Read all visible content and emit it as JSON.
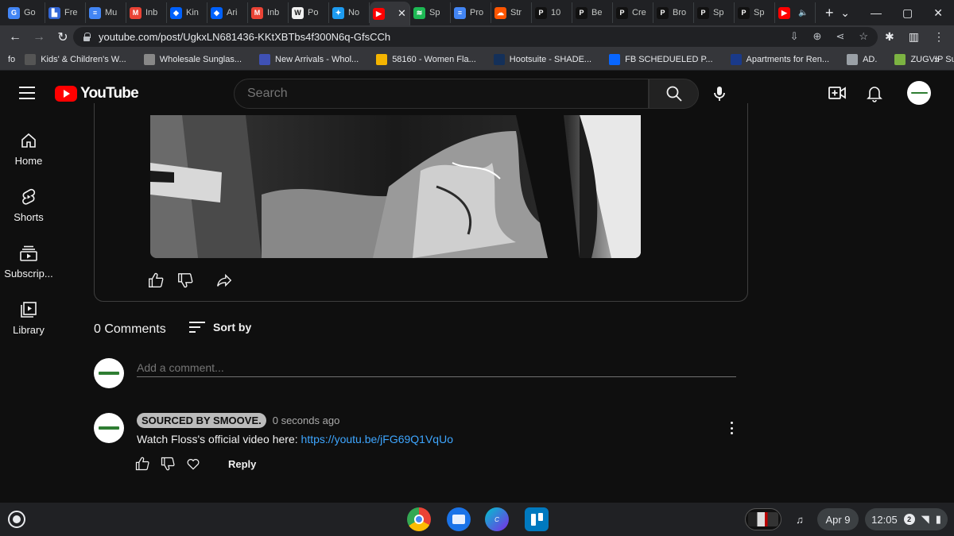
{
  "browser": {
    "tabs": [
      {
        "label": "Go",
        "color": "#4285f4",
        "glyph": "G"
      },
      {
        "label": "Fre",
        "color": "#3367d6",
        "glyph": "▙"
      },
      {
        "label": "Mu",
        "color": "#4285f4",
        "glyph": "≡"
      },
      {
        "label": "Inb",
        "color": "#ea4335",
        "glyph": "M"
      },
      {
        "label": "Kin",
        "color": "#0061fe",
        "glyph": "◆"
      },
      {
        "label": "Ari",
        "color": "#0061fe",
        "glyph": "◆"
      },
      {
        "label": "Inb",
        "color": "#ea4335",
        "glyph": "M"
      },
      {
        "label": "Po",
        "color": "#f1f1f1",
        "glyph": "W"
      },
      {
        "label": "No",
        "color": "#1d9bf0",
        "glyph": "✦"
      },
      {
        "label": "",
        "color": "#ff0000",
        "glyph": "▶",
        "active": true
      },
      {
        "label": "Sp",
        "color": "#1db954",
        "glyph": "≋"
      },
      {
        "label": "Pro",
        "color": "#4285f4",
        "glyph": "≡"
      },
      {
        "label": "Str",
        "color": "#ff5500",
        "glyph": "☁"
      },
      {
        "label": "10",
        "color": "#111111",
        "glyph": "P"
      },
      {
        "label": "Be",
        "color": "#111111",
        "glyph": "P"
      },
      {
        "label": "Cre",
        "color": "#111111",
        "glyph": "P"
      },
      {
        "label": "Bro",
        "color": "#111111",
        "glyph": "P"
      },
      {
        "label": "Sp",
        "color": "#111111",
        "glyph": "P"
      },
      {
        "label": "Sp",
        "color": "#111111",
        "glyph": "P"
      },
      {
        "label": "",
        "color": "#ff0000",
        "glyph": "▶"
      }
    ],
    "url": "youtube.com/post/UgkxLN681436-KKtXBTbs4f300N6q-GfsCCh",
    "bookmarks": [
      {
        "label": "Kids' & Children's W...",
        "color": "#555555"
      },
      {
        "label": "Wholesale Sunglas...",
        "color": "#888888"
      },
      {
        "label": "New Arrivals - Whol...",
        "color": "#3f51b5"
      },
      {
        "label": "58160 - Women Fla...",
        "color": "#f4b400"
      },
      {
        "label": "Hootsuite - SHADE...",
        "color": "#143059"
      },
      {
        "label": "FB SCHEDUELED P...",
        "color": "#0866ff"
      },
      {
        "label": "Apartments for Ren...",
        "color": "#1a3a8a"
      },
      {
        "label": "AD.",
        "color": "#9aa0a6"
      },
      {
        "label": "ZUGVIP Subscribe...",
        "color": "#7cb342"
      }
    ]
  },
  "yt": {
    "brand": "YouTube",
    "search_placeholder": "Search",
    "sidebar": [
      {
        "label": "Home"
      },
      {
        "label": "Shorts"
      },
      {
        "label": "Subscrip..."
      },
      {
        "label": "Library"
      }
    ]
  },
  "comments": {
    "count_label": "0 Comments",
    "sort_label": "Sort by",
    "input_placeholder": "Add a comment...",
    "items": [
      {
        "author": "SOURCED BY SMOOVE.",
        "time": "0 seconds ago",
        "text": "Watch Floss's official video here: ",
        "link": "https://youtu.be/jFG69Q1VqUo",
        "reply_label": "Reply"
      }
    ]
  },
  "shelf": {
    "date": "Apr 9",
    "time": "12:05",
    "notifications": "2"
  }
}
